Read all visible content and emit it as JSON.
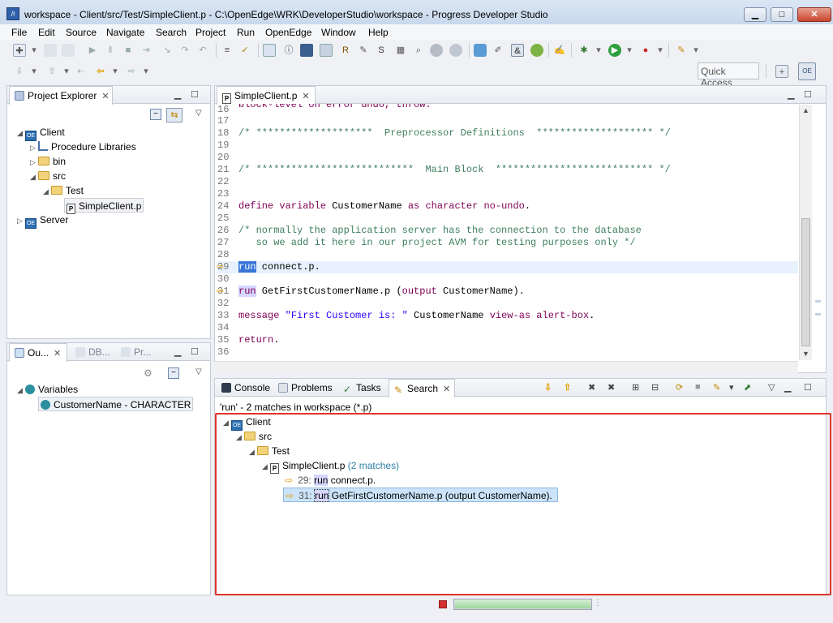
{
  "window": {
    "app_icon": "developer-studio-icon",
    "title": "workspace - Client/src/Test/SimpleClient.p - C:\\OpenEdge\\WRK\\DeveloperStudio\\workspace - Progress Developer Studio",
    "min_label": "▁",
    "max_label": "□",
    "close_label": "✕"
  },
  "menu": [
    "File",
    "Edit",
    "Source",
    "Navigate",
    "Search",
    "Project",
    "Run",
    "OpenEdge",
    "Window",
    "Help"
  ],
  "toolbar": {
    "quick_access_placeholder": "Quick Access",
    "perspective_label": "OE"
  },
  "project_explorer": {
    "tab_label": "Project Explorer",
    "tree": [
      {
        "label": "Client",
        "level": 0,
        "icon": "openedge-project-icon",
        "expanded": true
      },
      {
        "label": "Procedure Libraries",
        "level": 1,
        "icon": "library-icon",
        "expanded": false
      },
      {
        "label": "bin",
        "level": 1,
        "icon": "folder-icon",
        "expanded": false
      },
      {
        "label": "src",
        "level": 1,
        "icon": "folder-icon",
        "expanded": true
      },
      {
        "label": "Test",
        "level": 2,
        "icon": "folder-icon",
        "expanded": true
      },
      {
        "label": "SimpleClient.p",
        "level": 3,
        "icon": "procedure-file-icon",
        "selected": true
      },
      {
        "label": "Server",
        "level": 0,
        "icon": "openedge-project-icon",
        "expanded": false
      }
    ]
  },
  "outline": {
    "tabs": [
      "Ou...",
      "DB...",
      "Pr..."
    ],
    "variables_label": "Variables",
    "variable": "CustomerName - CHARACTER"
  },
  "editor": {
    "tab_label": "SimpleClient.p",
    "lines": [
      {
        "n": "16",
        "text": "block-level on error undo, throw."
      },
      {
        "n": "17",
        "text": ""
      },
      {
        "n": "18",
        "text": "/* ********************  Preprocessor Definitions  ******************** */"
      },
      {
        "n": "19",
        "text": ""
      },
      {
        "n": "20",
        "text": ""
      },
      {
        "n": "21",
        "text": "/* ***************************  Main Block  *************************** */"
      },
      {
        "n": "22",
        "text": ""
      },
      {
        "n": "23",
        "text": ""
      },
      {
        "n": "24",
        "text": "define variable CustomerName as character no-undo."
      },
      {
        "n": "25",
        "text": ""
      },
      {
        "n": "26",
        "text": "/* normally the application server has the connection to the database"
      },
      {
        "n": "27",
        "text": "   so we add it here in our project AVM for testing purposes only */"
      },
      {
        "n": "28",
        "text": ""
      },
      {
        "n": "29",
        "text": "run connect.p."
      },
      {
        "n": "30",
        "text": ""
      },
      {
        "n": "31",
        "text": "run GetFirstCustomerName.p (output CustomerName)."
      },
      {
        "n": "32",
        "text": ""
      },
      {
        "n": "33",
        "text": "message \"First Customer is: \" CustomerName view-as alert-box."
      },
      {
        "n": "34",
        "text": ""
      },
      {
        "n": "35",
        "text": "return."
      },
      {
        "n": "36",
        "text": ""
      }
    ],
    "code": {
      "l16_a": "block-level on error undo, throw.",
      "l18": "/* ********************  Preprocessor Definitions  ******************** */",
      "l21": "/* ***************************  Main Block  *************************** */",
      "l24_kw1": "define variable",
      "l24_id": " CustomerName ",
      "l24_kw2": "as character no-undo",
      "l24_end": ".",
      "l26": "/* normally the application server has the connection to the database",
      "l27": "   so we add it here in our project AVM for testing purposes only */",
      "l29_kw": "run",
      "l29_rest": " connect.p.",
      "l31_kw": "run",
      "l31_a": " GetFirstCustomerName.p (",
      "l31_kw2": "output",
      "l31_b": " CustomerName).",
      "l33_kw": "message",
      "l33_str": " \"First Customer is: \"",
      "l33_id": " CustomerName ",
      "l33_kw2": "view-as alert-box",
      "l33_end": ".",
      "l35_kw": "return",
      "l35_end": "."
    }
  },
  "bottom_tabs": [
    {
      "label": "Console"
    },
    {
      "label": "Problems"
    },
    {
      "label": "Tasks"
    },
    {
      "label": "Search",
      "active": true
    }
  ],
  "search": {
    "summary": "'run' - 2 matches in workspace (*.p)",
    "tree": {
      "client": "Client",
      "src": "src",
      "test": "Test",
      "file": "SimpleClient.p",
      "file_matches": "(2 matches)",
      "match1_line": "29:",
      "match1_kw": "run",
      "match1_rest": " connect.p.",
      "match2_line": "31:",
      "match2_kw": "run",
      "match2_rest": " GetFirstCustomerName.p (output CustomerName)."
    }
  },
  "status": {
    "progress": 1.0
  },
  "colors": {
    "highlight_box": "#e0342a",
    "selection": "#cce4fa",
    "match_count": "#2f7fa6"
  }
}
